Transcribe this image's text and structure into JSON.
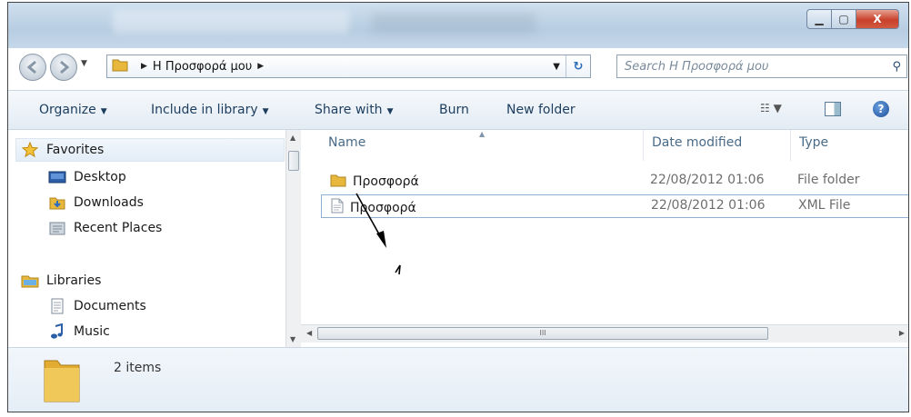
{
  "window": {
    "controls": {
      "minimize": "▁",
      "maximize": "▢",
      "close": "X"
    }
  },
  "address": {
    "crumb_sep": "▶",
    "path": "Η Προσφορά μου",
    "search_placeholder": "Search Η Προσφορά μου"
  },
  "toolbar": {
    "organize": "Organize",
    "include": "Include in library",
    "share": "Share with",
    "burn": "Burn",
    "new_folder": "New folder"
  },
  "sidebar": {
    "favorites": "Favorites",
    "desktop": "Desktop",
    "downloads": "Downloads",
    "recent": "Recent Places",
    "libraries": "Libraries",
    "documents": "Documents",
    "music": "Music"
  },
  "columns": {
    "name": "Name",
    "date": "Date modified",
    "type": "Type"
  },
  "files": [
    {
      "name": "Προσφορά",
      "date": "22/08/2012 01:06",
      "type": "File folder",
      "icon": "folder-icon"
    },
    {
      "name": "Προσφορά",
      "date": "22/08/2012 01:06",
      "type": "XML File",
      "icon": "xml-file-icon"
    }
  ],
  "details": {
    "count": "2 items"
  },
  "scroll": {
    "grip": "III"
  },
  "colors": {
    "accent": "#1c3d5e",
    "selection_border": "#8fb0d3",
    "folder": "#e8b83c"
  }
}
